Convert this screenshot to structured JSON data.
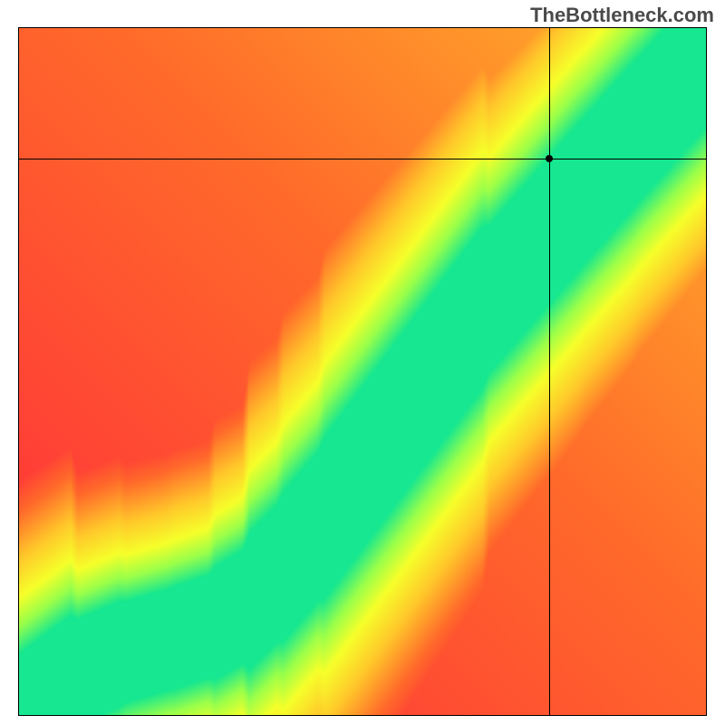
{
  "watermark": "TheBottleneck.com",
  "chart_data": {
    "type": "heatmap",
    "title": "",
    "xlabel": "",
    "ylabel": "",
    "xlim": [
      0,
      100
    ],
    "ylim": [
      0,
      100
    ],
    "grid": false,
    "legend": false,
    "marker": {
      "x": 77,
      "y": 81
    },
    "crosshair_x": 77,
    "crosshair_y": 81,
    "color_stops": [
      {
        "t": 0.0,
        "color": "#ff2a3c"
      },
      {
        "t": 0.25,
        "color": "#ff6a2a"
      },
      {
        "t": 0.5,
        "color": "#ffc92a"
      },
      {
        "t": 0.7,
        "color": "#f6ff2a"
      },
      {
        "t": 0.85,
        "color": "#9aff4a"
      },
      {
        "t": 1.0,
        "color": "#16e790"
      }
    ],
    "optimal_curve": [
      {
        "x": 0,
        "y": 0
      },
      {
        "x": 8,
        "y": 6
      },
      {
        "x": 15,
        "y": 9
      },
      {
        "x": 22,
        "y": 11
      },
      {
        "x": 28,
        "y": 13
      },
      {
        "x": 33,
        "y": 16
      },
      {
        "x": 38,
        "y": 21
      },
      {
        "x": 44,
        "y": 28
      },
      {
        "x": 50,
        "y": 36
      },
      {
        "x": 56,
        "y": 44
      },
      {
        "x": 62,
        "y": 52
      },
      {
        "x": 68,
        "y": 60
      },
      {
        "x": 75,
        "y": 68
      },
      {
        "x": 82,
        "y": 76
      },
      {
        "x": 90,
        "y": 85
      },
      {
        "x": 100,
        "y": 96
      }
    ],
    "band_half_width": 7,
    "band_feather": 22
  }
}
